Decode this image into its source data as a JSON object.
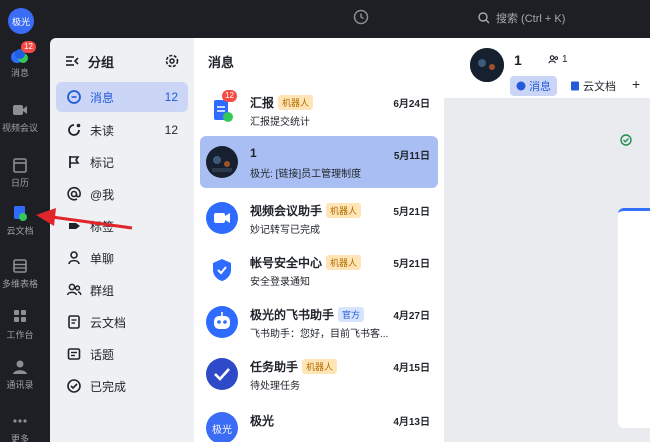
{
  "rail": {
    "avatar_text": "极光",
    "items": [
      {
        "label": "消息",
        "icon": "chat-bubble-icon",
        "badge": "12"
      },
      {
        "label": "视频会议",
        "icon": "video-camera-icon"
      },
      {
        "label": "日历",
        "icon": "calendar-icon"
      },
      {
        "label": "云文档",
        "icon": "cloud-doc-icon"
      },
      {
        "label": "多维表格",
        "icon": "base-table-icon"
      },
      {
        "label": "工作台",
        "icon": "app-grid-icon"
      },
      {
        "label": "通讯录",
        "icon": "contacts-icon"
      },
      {
        "label": "更多",
        "icon": "more-icon"
      }
    ]
  },
  "topbar": {
    "search_text": "搜索 (Ctrl + K)"
  },
  "groups": {
    "title": "分组",
    "items": [
      {
        "label": "消息",
        "count": "12",
        "icon": "chat-icon",
        "active": true
      },
      {
        "label": "未读",
        "count": "12",
        "icon": "unread-icon"
      },
      {
        "label": "标记",
        "icon": "flag-icon"
      },
      {
        "label": "@我",
        "icon": "at-icon"
      },
      {
        "label": "标签",
        "icon": "tag-icon"
      },
      {
        "label": "单聊",
        "icon": "person-icon"
      },
      {
        "label": "群组",
        "icon": "group-icon"
      },
      {
        "label": "云文档",
        "icon": "doc-icon"
      },
      {
        "label": "话题",
        "icon": "topic-icon"
      },
      {
        "label": "已完成",
        "icon": "check-circle-icon"
      }
    ]
  },
  "messages": {
    "title": "消息",
    "chats": [
      {
        "name": "汇报",
        "tag": "机器人",
        "date": "6月24日",
        "preview": "汇报提交统计",
        "badge": "12"
      },
      {
        "name": "1",
        "date": "5月11日",
        "preview": "极光: [链接]员工管理制度",
        "active": true
      },
      {
        "name": "视频会议助手",
        "tag": "机器人",
        "date": "5月21日",
        "preview": "妙记转写已完成"
      },
      {
        "name": "帐号安全中心",
        "tag": "机器人",
        "date": "5月21日",
        "preview": "安全登录通知"
      },
      {
        "name": "极光的飞书助手",
        "tag": "官方",
        "date": "4月27日",
        "preview": "飞书助手：您好，目前飞书客..."
      },
      {
        "name": "任务助手",
        "tag": "机器人",
        "date": "4月15日",
        "preview": "待处理任务"
      },
      {
        "name": "极光",
        "avatar_text": "极光",
        "date": "4月13日",
        "preview": ""
      }
    ]
  },
  "chat_pane": {
    "title": "1",
    "members": "1",
    "tabs": [
      {
        "label": "消息",
        "icon": "chat-icon",
        "active": true
      },
      {
        "label": "云文档",
        "icon": "doc-icon"
      }
    ],
    "add_label": "+"
  },
  "colors": {
    "accent": "#3370ff",
    "active_bg": "#cbd6f7",
    "arrow": "#e0262a",
    "badge": "#f54a45"
  }
}
